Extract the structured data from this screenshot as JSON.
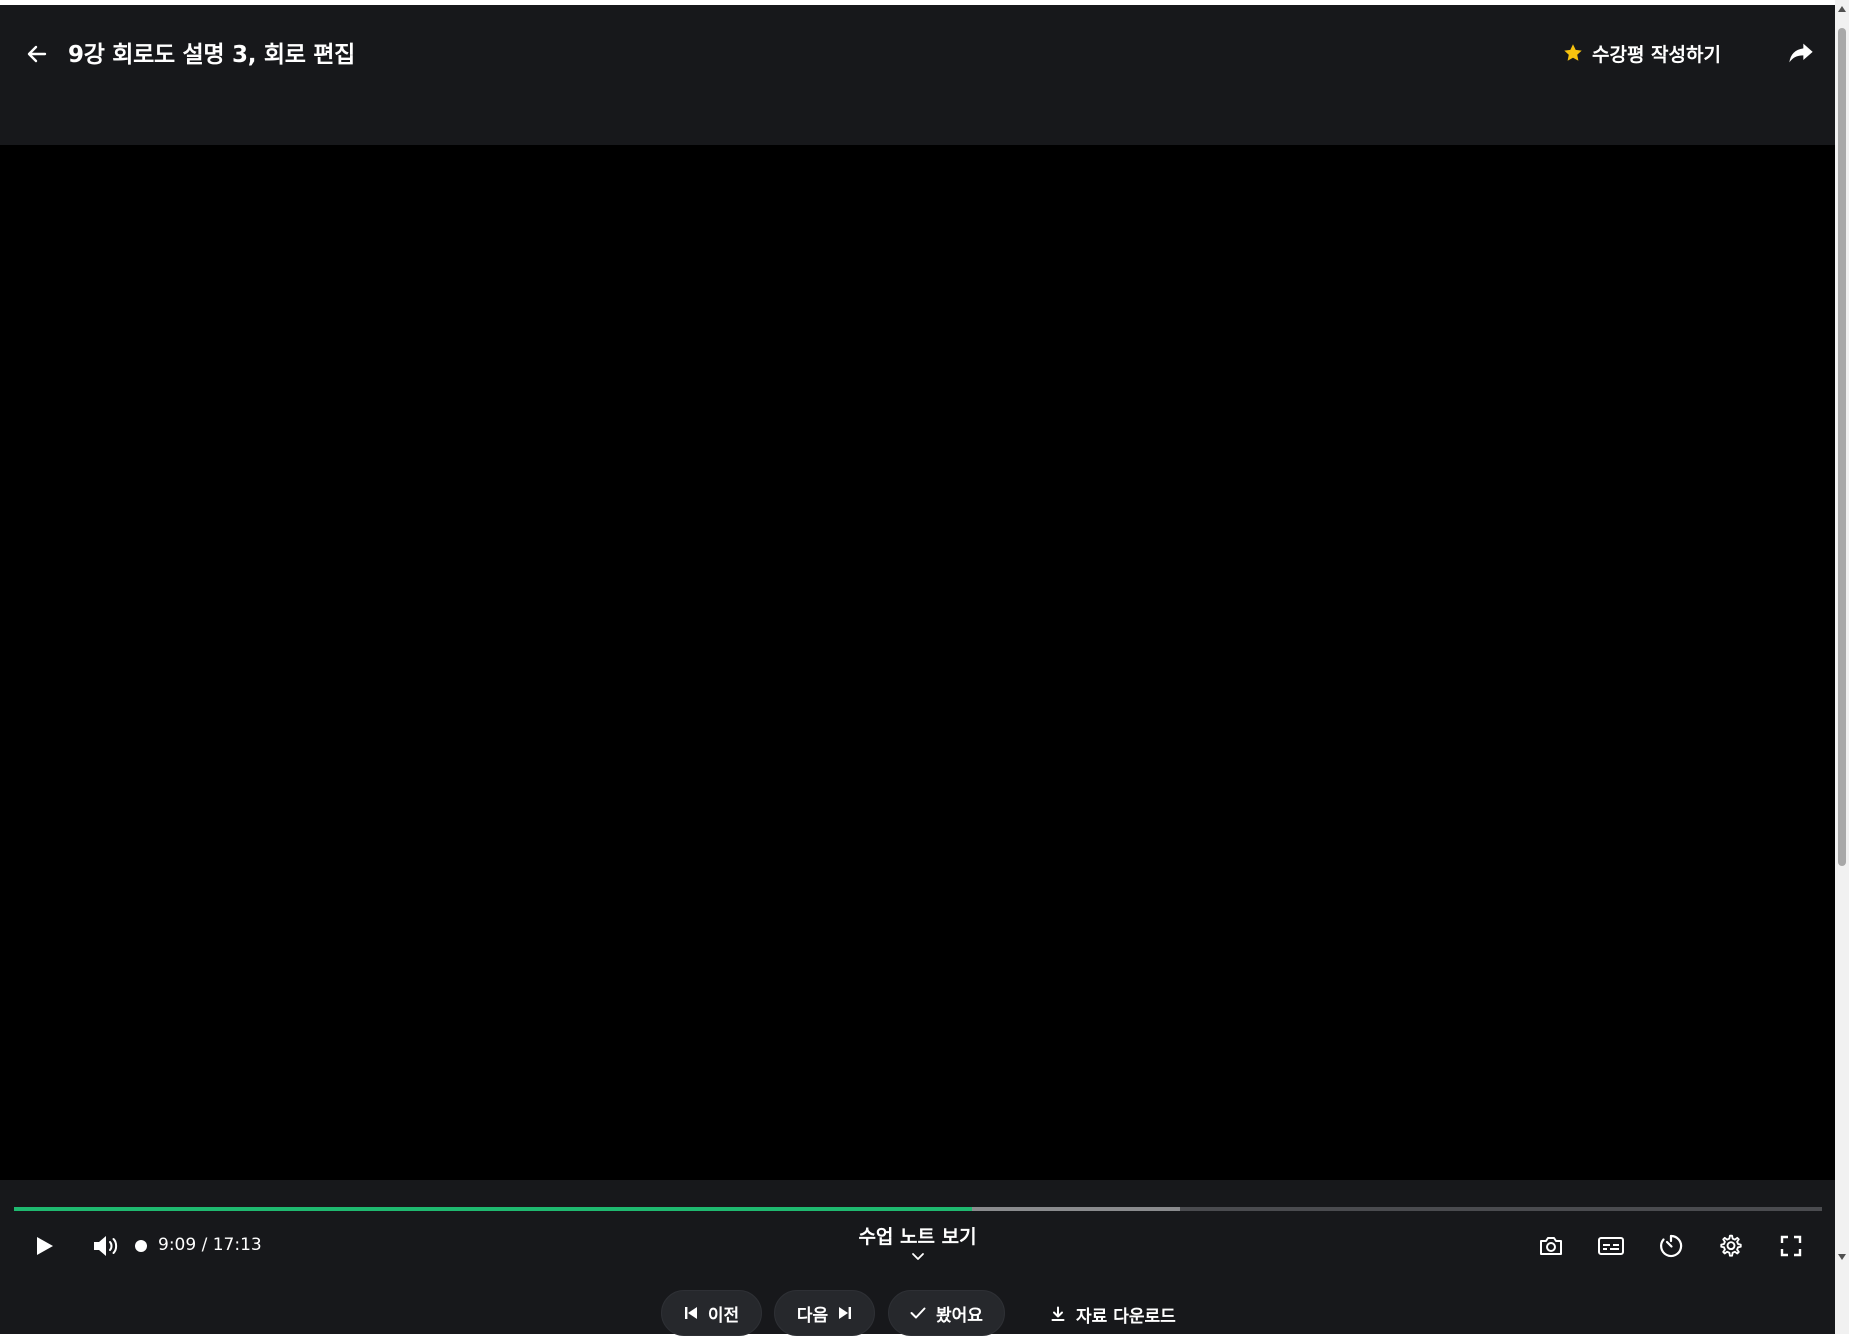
{
  "header": {
    "title": "9강 회로도 설명 3, 회로 편집",
    "review_label": "수강평 작성하기",
    "icons": [
      "arrow-left-icon",
      "star-icon",
      "share-icon"
    ]
  },
  "player": {
    "time_display": "9:09 / 17:13",
    "played_fraction": 0.53,
    "buffered_fraction": 0.645,
    "notes_label": "수업 노트 보기",
    "icons": [
      "play-icon",
      "volume-icon",
      "camera-icon",
      "subtitles-icon",
      "timer-icon",
      "settings-icon",
      "fullscreen-icon"
    ]
  },
  "nav": {
    "prev_label": "이전",
    "next_label": "다음",
    "watched_label": "봤어요",
    "download_label": "자료 다운로드"
  },
  "colors": {
    "background": "#17181b",
    "video": "#000000",
    "progress_played": "#1fb970",
    "star": "#f6c20f"
  }
}
